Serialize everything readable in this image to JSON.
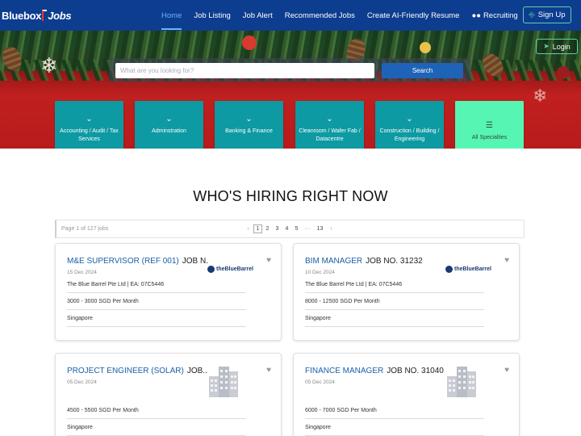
{
  "nav": {
    "logo_left": "Bluebox",
    "logo_right": "Jobs",
    "links": [
      "Home",
      "Job Listing",
      "Job Alert",
      "Recommended Jobs",
      "Create AI-Friendly Resume",
      "Recruiting"
    ],
    "signup": "Sign Up",
    "accent": "#0d3d8f"
  },
  "hero": {
    "login": "Login",
    "search_placeholder": "What are you looking for?",
    "search_button": "Search",
    "categories": [
      "Accounting / Audit / Tax Services",
      "Adminstration",
      "Banking & Finance",
      "Cleanroom / Wafer Fab / Datacentre",
      "Construction / Building / Engineering",
      "All Specialties"
    ]
  },
  "section_title": "WHO'S HIRING RIGHT NOW",
  "pager": {
    "info": "Page 1 of 127 jobs",
    "pages": [
      "1",
      "2",
      "3",
      "4",
      "5",
      "···",
      "13"
    ]
  },
  "jobs": [
    {
      "role": "M&E SUPERVISOR (REF 001)",
      "jobno": "JOB N...",
      "date": "15 Dec 2024",
      "company": "The Blue Barrel Pte Ltd | EA: 07C5446",
      "salary": "3000 - 3000 SGD Per Month",
      "location": "Singapore",
      "brand": "theBlueBarrel"
    },
    {
      "role": "BIM MANAGER",
      "jobno": "JOB NO. 31232",
      "date": "10 Dec 2024",
      "company": "The Blue Barrel Pte Ltd | EA: 07C5446",
      "salary": "8000 - 12500 SGD Per Month",
      "location": "Singapore",
      "brand": "theBlueBarrel"
    },
    {
      "role": "PROJECT ENGINEER (SOLAR)",
      "jobno": "JOB...",
      "date": "05 Dec 2024",
      "salary": "4500 - 5500 SGD Per Month",
      "location": "Singapore"
    },
    {
      "role": "FINANCE MANAGER",
      "jobno": "JOB NO. 31040",
      "date": "05 Dec 2024",
      "salary": "6000 - 7000 SGD Per Month",
      "location": "Singapore"
    }
  ],
  "icons": {
    "category": "chevron-down-icon",
    "all": "list-icon",
    "favorite": "heart-icon",
    "recruiting": "users-icon",
    "signup": "user-plus-icon",
    "login": "login-icon"
  }
}
